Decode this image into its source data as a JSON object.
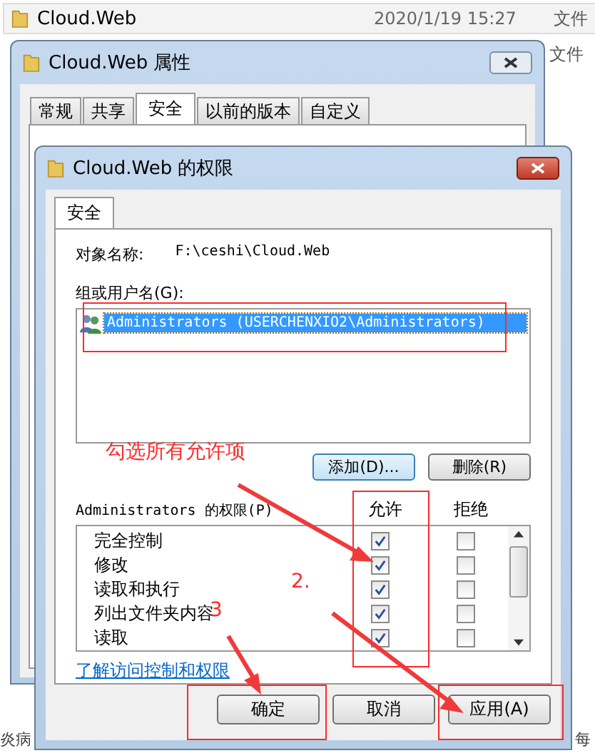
{
  "background": {
    "row": {
      "name": "Cloud.Web",
      "date": "2020/1/19 15:27",
      "type": "文件"
    },
    "second_row_type": "文件",
    "bottom_left_text": "炎病",
    "bottom_right_text": "每"
  },
  "properties_window": {
    "title": "Cloud.Web 属性",
    "tabs": [
      {
        "label": "常规",
        "selected": false
      },
      {
        "label": "共享",
        "selected": false
      },
      {
        "label": "安全",
        "selected": true
      },
      {
        "label": "以前的版本",
        "selected": false
      },
      {
        "label": "自定义",
        "selected": false
      }
    ]
  },
  "permissions_dialog": {
    "title": "Cloud.Web 的权限",
    "tab": "安全",
    "object_label": "对象名称:",
    "object_path": "F:\\ceshi\\Cloud.Web",
    "group_label": "组或用户名(G):",
    "users": [
      {
        "name": "Administrators (USERCHENXIO2\\Administrators)",
        "selected": true
      }
    ],
    "add_button": "添加(D)...",
    "remove_button": "删除(R)",
    "permissions_label": "Administrators 的权限(P)",
    "allow_header": "允许",
    "deny_header": "拒绝",
    "permissions": [
      {
        "name": "完全控制",
        "allow": true,
        "deny": false
      },
      {
        "name": "修改",
        "allow": true,
        "deny": false
      },
      {
        "name": "读取和执行",
        "allow": true,
        "deny": false
      },
      {
        "name": "列出文件夹内容",
        "allow": true,
        "deny": false
      },
      {
        "name": "读取",
        "allow": true,
        "deny": false
      }
    ],
    "link": "了解访问控制和权限",
    "buttons": [
      "确定",
      "取消",
      "应用(A)"
    ]
  },
  "annotations": {
    "instruction": "勾选所有允许项",
    "step_2": "2.",
    "step_3": "3"
  }
}
